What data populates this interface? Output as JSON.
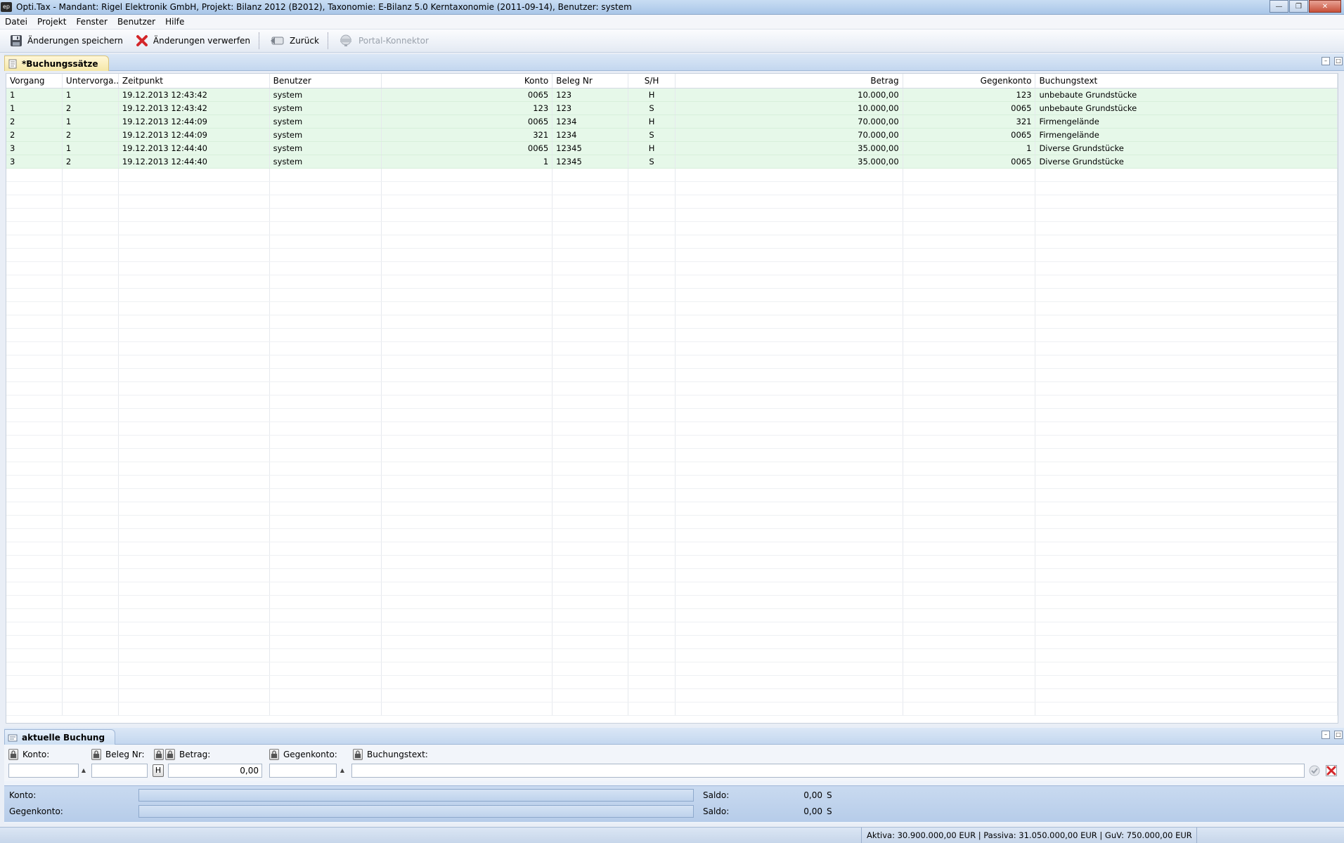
{
  "window": {
    "title": "Opti.Tax - Mandant: Rigel Elektronik GmbH, Projekt: Bilanz 2012 (B2012), Taxonomie: E-Bilanz 5.0 Kerntaxonomie (2011-09-14), Benutzer: system",
    "app_icon_text": "ep"
  },
  "menu": [
    "Datei",
    "Projekt",
    "Fenster",
    "Benutzer",
    "Hilfe"
  ],
  "toolbar": {
    "save": "Änderungen speichern",
    "discard": "Änderungen verwerfen",
    "back": "Zurück",
    "portal": "Portal-Konnektor"
  },
  "top_pane": {
    "tab_label": "*Buchungssätze"
  },
  "table": {
    "columns": [
      "Vorgang",
      "Untervorga...",
      "Zeitpunkt",
      "Benutzer",
      "Konto",
      "Beleg Nr",
      "S/H",
      "Betrag",
      "Gegenkonto",
      "Buchungstext"
    ],
    "rows": [
      [
        "1",
        "1",
        "19.12.2013 12:43:42",
        "system",
        "0065",
        "123",
        "H",
        "10.000,00",
        "123",
        "unbebaute Grundstücke"
      ],
      [
        "1",
        "2",
        "19.12.2013 12:43:42",
        "system",
        "123",
        "123",
        "S",
        "10.000,00",
        "0065",
        "unbebaute Grundstücke"
      ],
      [
        "2",
        "1",
        "19.12.2013 12:44:09",
        "system",
        "0065",
        "1234",
        "H",
        "70.000,00",
        "321",
        "Firmengelände"
      ],
      [
        "2",
        "2",
        "19.12.2013 12:44:09",
        "system",
        "321",
        "1234",
        "S",
        "70.000,00",
        "0065",
        "Firmengelände"
      ],
      [
        "3",
        "1",
        "19.12.2013 12:44:40",
        "system",
        "0065",
        "12345",
        "H",
        "35.000,00",
        "1",
        "Diverse Grundstücke"
      ],
      [
        "3",
        "2",
        "19.12.2013 12:44:40",
        "system",
        "1",
        "12345",
        "S",
        "35.000,00",
        "0065",
        "Diverse Grundstücke"
      ]
    ]
  },
  "bottom_pane": {
    "tab_label": "aktuelle Buchung",
    "labels": {
      "konto": "Konto:",
      "beleg": "Beleg Nr:",
      "betrag": "Betrag:",
      "gegenkonto": "Gegenkonto:",
      "buchungstext": "Buchungstext:"
    },
    "values": {
      "konto": "",
      "beleg": "",
      "sh_toggle": "H",
      "betrag": "0,00",
      "gegenkonto": "",
      "buchungstext": ""
    },
    "saldo": {
      "konto_label": "Konto:",
      "gegenkonto_label": "Gegenkonto:",
      "saldo_label": "Saldo:",
      "konto_saldo": "0,00",
      "konto_sh": "S",
      "gegenkonto_saldo": "0,00",
      "gegenkonto_sh": "S"
    }
  },
  "status": "Aktiva: 30.900.000,00 EUR | Passiva: 31.050.000,00 EUR | GuV: 750.000,00 EUR"
}
